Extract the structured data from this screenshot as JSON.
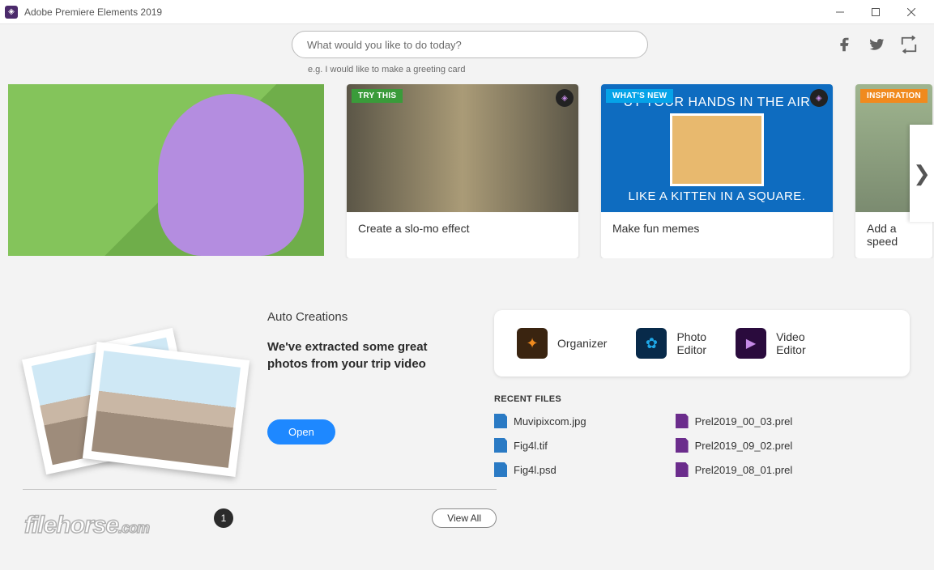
{
  "titlebar": {
    "app_title": "Adobe Premiere Elements 2019"
  },
  "header": {
    "search_placeholder": "What would you like to do today?",
    "search_hint": "e.g. I would like to make a greeting card"
  },
  "carousel": {
    "card1": {
      "badge": "TRY THIS",
      "caption": "Create a slo-mo effect"
    },
    "card2": {
      "badge": "WHAT'S NEW",
      "meme_top": "UT YOUR HANDS IN THE AIR",
      "meme_bottom": "LIKE A KITTEN IN A SQUARE.",
      "caption": "Make fun memes"
    },
    "card3": {
      "badge": "INSPIRATION",
      "caption": "Add a speed"
    }
  },
  "auto_creations": {
    "title": "Auto Creations",
    "subtitle": "We've extracted some great photos from your trip video",
    "open_label": "Open"
  },
  "launcher": {
    "organizer": "Organizer",
    "photo_line1": "Photo",
    "photo_line2": "Editor",
    "video_line1": "Video",
    "video_line2": "Editor"
  },
  "recent": {
    "heading": "RECENT FILES",
    "left": [
      "Muvipixcom.jpg",
      "Fig4l.tif",
      "Fig4l.psd"
    ],
    "right": [
      "Prel2019_00_03.prel",
      "Prel2019_09_02.prel",
      "Prel2019_08_01.prel"
    ]
  },
  "footer": {
    "page": "1",
    "viewall": "View All",
    "watermark": "filehorse",
    "watermark_suffix": ".com"
  }
}
